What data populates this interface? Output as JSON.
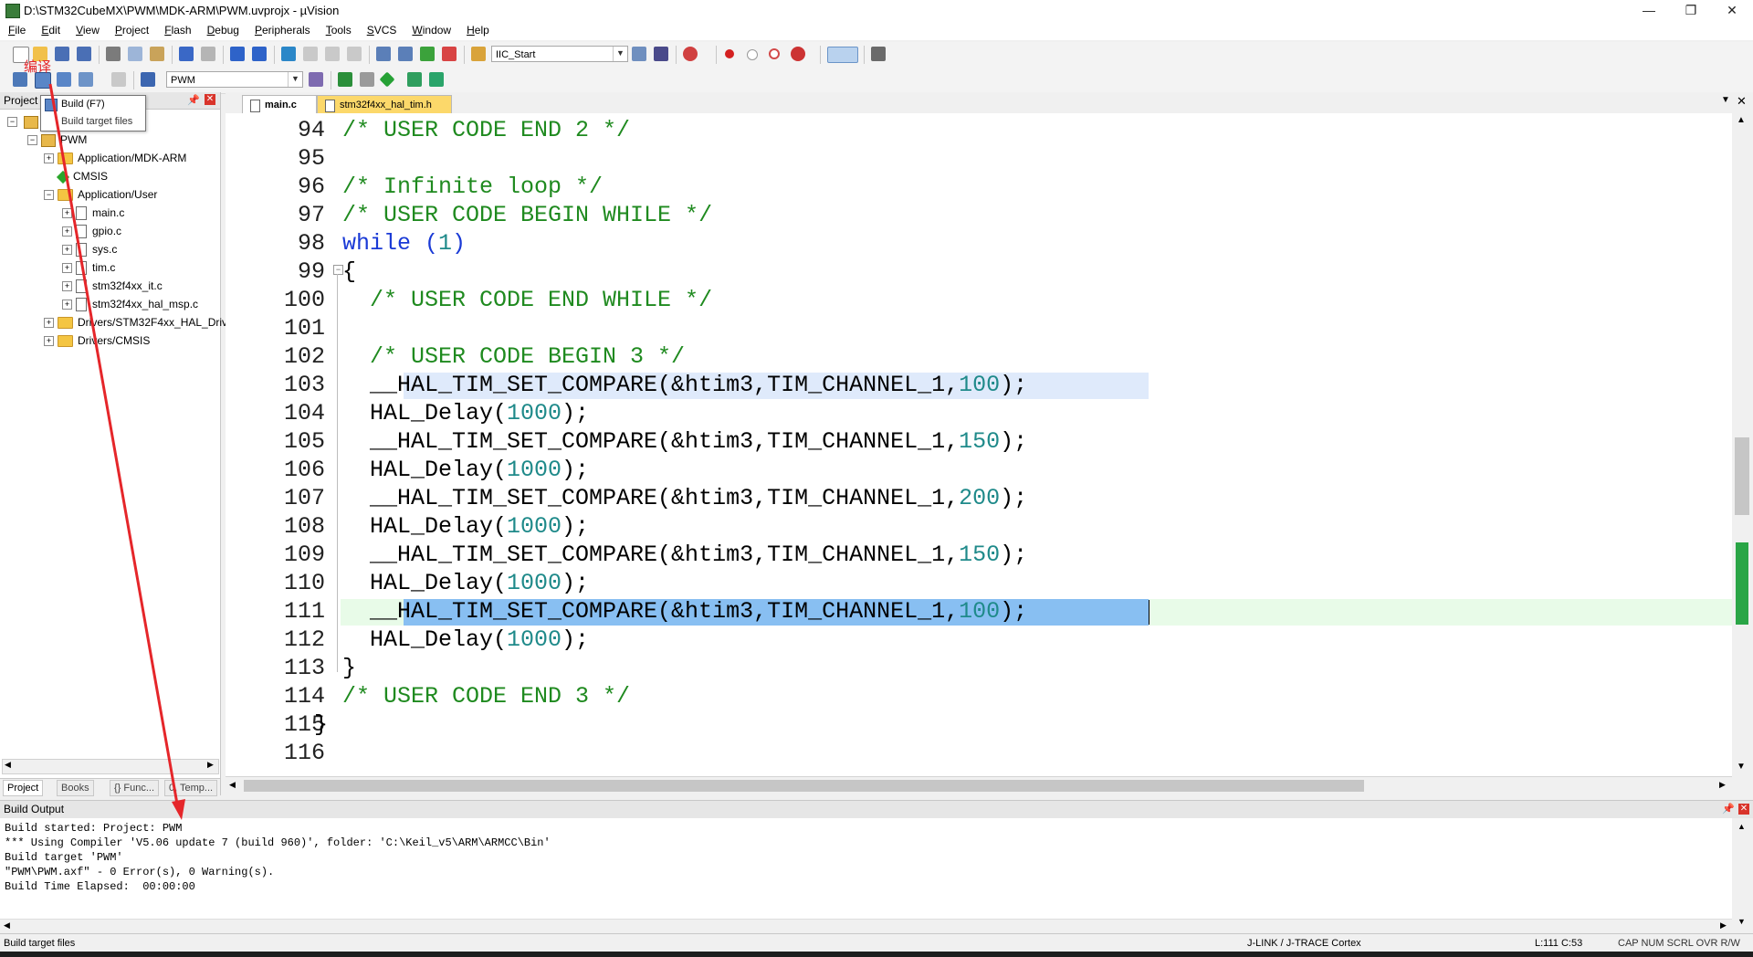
{
  "window": {
    "title": "D:\\STM32CubeMX\\PWM\\MDK-ARM\\PWM.uvprojx - µVision",
    "controls": {
      "minimize": "—",
      "maximize": "❐",
      "close": "✕"
    }
  },
  "menu": [
    "File",
    "Edit",
    "View",
    "Project",
    "Flash",
    "Debug",
    "Peripherals",
    "Tools",
    "SVCS",
    "Window",
    "Help"
  ],
  "toolbar": {
    "find_combo_value": "IIC_Start",
    "target_combo_value": "PWM",
    "annotation_text": "编译"
  },
  "tooltip": {
    "title": "Build (F7)",
    "description": "Build target files"
  },
  "project_pane": {
    "header": "Project",
    "tree": [
      {
        "label": "PWM",
        "type": "target",
        "indent": 1,
        "expanded": true
      },
      {
        "label": "Application/MDK-ARM",
        "type": "folder",
        "indent": 2,
        "expanded": false
      },
      {
        "label": "CMSIS",
        "type": "component",
        "indent": 2
      },
      {
        "label": "Application/User",
        "type": "folder",
        "indent": 2,
        "expanded": true
      },
      {
        "label": "main.c",
        "type": "file",
        "indent": 3
      },
      {
        "label": "gpio.c",
        "type": "file",
        "indent": 3
      },
      {
        "label": "sys.c",
        "type": "file",
        "indent": 3
      },
      {
        "label": "tim.c",
        "type": "file",
        "indent": 3
      },
      {
        "label": "stm32f4xx_it.c",
        "type": "file",
        "indent": 3
      },
      {
        "label": "stm32f4xx_hal_msp.c",
        "type": "file",
        "indent": 3
      },
      {
        "label": "Drivers/STM32F4xx_HAL_Driv",
        "type": "folder",
        "indent": 2,
        "expanded": false
      },
      {
        "label": "Drivers/CMSIS",
        "type": "folder",
        "indent": 2,
        "expanded": false
      }
    ],
    "tabs": [
      "Project",
      "Books",
      "{} Func...",
      "0, Temp..."
    ]
  },
  "editor": {
    "tabs": [
      {
        "label": "main.c",
        "active": true
      },
      {
        "label": "stm32f4xx_hal_tim.h",
        "active": false
      }
    ],
    "lines": [
      {
        "n": "94",
        "code": "/* USER CODE END 2 */"
      },
      {
        "n": "95",
        "code": ""
      },
      {
        "n": "96",
        "code": "/* Infinite loop */"
      },
      {
        "n": "97",
        "code": "/* USER CODE BEGIN WHILE */"
      },
      {
        "n": "98",
        "code": "while (1)"
      },
      {
        "n": "99",
        "code": "{"
      },
      {
        "n": "100",
        "code": "  /* USER CODE END WHILE */"
      },
      {
        "n": "101",
        "code": ""
      },
      {
        "n": "102",
        "code": "  /* USER CODE BEGIN 3 */"
      },
      {
        "n": "103",
        "code": "  __HAL_TIM_SET_COMPARE(&htim3,TIM_CHANNEL_1,100);"
      },
      {
        "n": "104",
        "code": "  HAL_Delay(1000);"
      },
      {
        "n": "105",
        "code": "  __HAL_TIM_SET_COMPARE(&htim3,TIM_CHANNEL_1,150);"
      },
      {
        "n": "106",
        "code": "  HAL_Delay(1000);"
      },
      {
        "n": "107",
        "code": "  __HAL_TIM_SET_COMPARE(&htim3,TIM_CHANNEL_1,200);"
      },
      {
        "n": "108",
        "code": "  HAL_Delay(1000);"
      },
      {
        "n": "109",
        "code": "  __HAL_TIM_SET_COMPARE(&htim3,TIM_CHANNEL_1,150);"
      },
      {
        "n": "110",
        "code": "  HAL_Delay(1000);"
      },
      {
        "n": "111",
        "code": "  __HAL_TIM_SET_COMPARE(&htim3,TIM_CHANNEL_1,100);"
      },
      {
        "n": "112",
        "code": "  HAL_Delay(1000);"
      },
      {
        "n": "113",
        "code": "}"
      },
      {
        "n": "114",
        "code": "/* USER CODE END 3 */"
      },
      {
        "n": "115",
        "code": "}"
      },
      {
        "n": "116",
        "code": ""
      }
    ]
  },
  "build_output": {
    "header": "Build Output",
    "lines": [
      "Build started: Project: PWM",
      "*** Using Compiler 'V5.06 update 7 (build 960)', folder: 'C:\\Keil_v5\\ARM\\ARMCC\\Bin'",
      "Build target 'PWM'",
      "\"PWM\\PWM.axf\" - 0 Error(s), 0 Warning(s).",
      "Build Time Elapsed:  00:00:00"
    ]
  },
  "status_bar": {
    "left": "Build target files",
    "debugger": "J-LINK / J-TRACE Cortex",
    "position": "L:111 C:53",
    "indicators": "CAP  NUM  SCRL  OVR  R/W"
  }
}
